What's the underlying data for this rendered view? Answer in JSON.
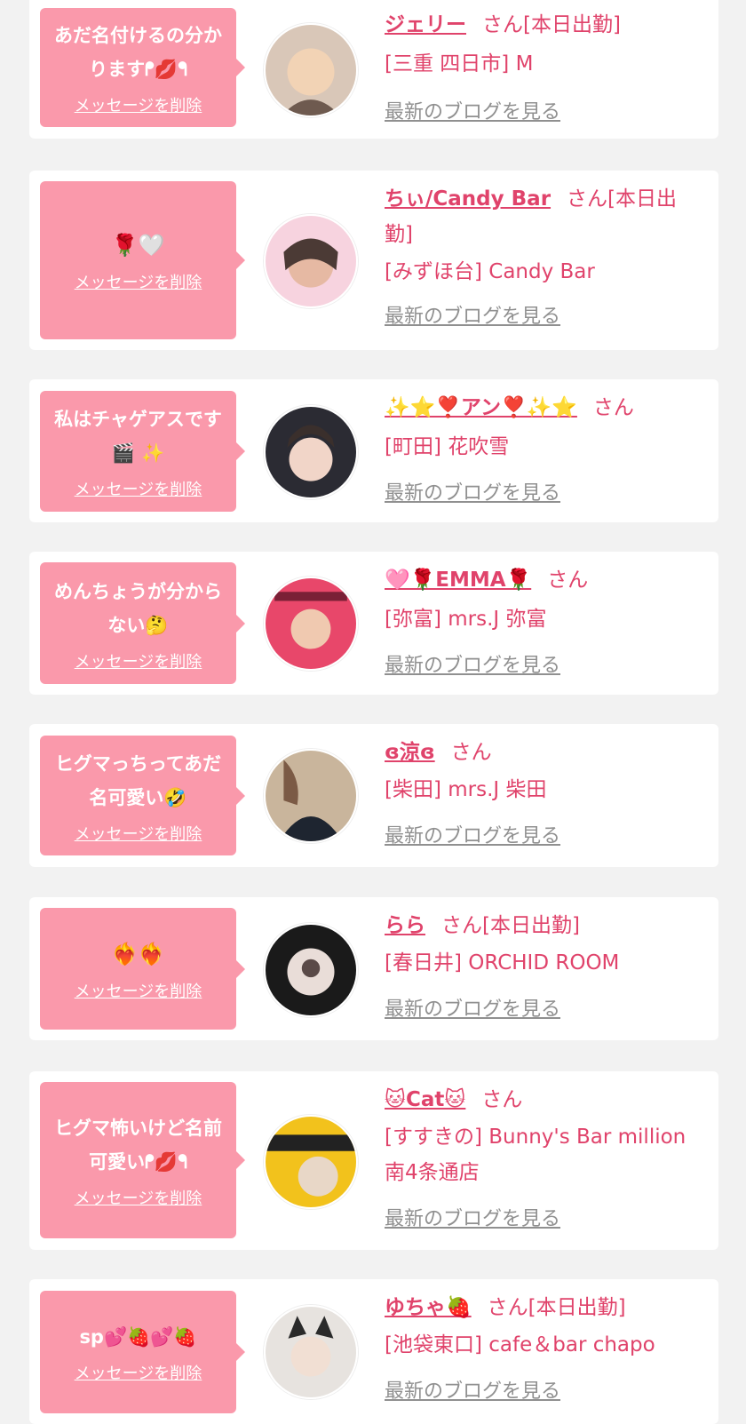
{
  "delete_label": "メッセージを削除",
  "blog_label": "最新のブログを見る",
  "cards": [
    {
      "message": "あだ名付けるの分かりますᖰ💋ᖳ",
      "name": "ジェリー",
      "suffix": "さん[本日出勤]",
      "shop": "[三重 四日市] M",
      "avatar_colors": [
        "#d9c7b8",
        "#f2d3b5",
        "#6e5a4f"
      ]
    },
    {
      "message": "🌹🤍",
      "name": "ちぃ/Candy Bar",
      "suffix": "さん[本日出勤]",
      "shop": "[みずほ台] Candy Bar",
      "avatar_colors": [
        "#f7d3df",
        "#e6b9a3",
        "#4b3a35"
      ]
    },
    {
      "message": "私はチャゲアスです🎬 ✨",
      "name": "✨⭐❣️アン❣️✨⭐",
      "suffix": "さん",
      "shop": "[町田] 花吹雪",
      "avatar_colors": [
        "#2b2b33",
        "#f1d5c8",
        "#3a2f2c"
      ]
    },
    {
      "message": "めんちょうが分からない🤔",
      "name": "🩷🌹EMMA🌹",
      "suffix": "さん",
      "shop": "[弥富] mrs.J 弥富",
      "avatar_colors": [
        "#e8476a",
        "#f0c9b0",
        "#7a2036"
      ]
    },
    {
      "message": "ヒグマっちってあだ名可愛い🤣",
      "name": "ɞ涼ɞ",
      "suffix": "さん",
      "shop": "[柴田] mrs.J 柴田",
      "avatar_colors": [
        "#c9b59c",
        "#1e2530",
        "#7b5a45"
      ]
    },
    {
      "message": "❤️‍🔥❤️‍🔥",
      "name": "らら",
      "suffix": "さん[本日出勤]",
      "shop": "[春日井] ORCHID ROOM",
      "avatar_colors": [
        "#1a1a1a",
        "#e9ddd8",
        "#5a4a48"
      ]
    },
    {
      "message": "ヒグマ怖いけど名前可愛いᖰ💋ᖳ",
      "name": "🐱Cat🐱",
      "suffix": "さん",
      "shop": "[すすきの] Bunny's Bar million 南4条通店",
      "avatar_colors": [
        "#f2c21c",
        "#222222",
        "#e8d7c7"
      ]
    },
    {
      "message": "sp💕🍓💕🍓",
      "name": "ゆちゃ🍓",
      "suffix": "さん[本日出勤]",
      "shop": "[池袋東口] cafe＆bar chapo",
      "avatar_colors": [
        "#e7e3df",
        "#2a2a2a",
        "#f1dfd3"
      ]
    }
  ]
}
